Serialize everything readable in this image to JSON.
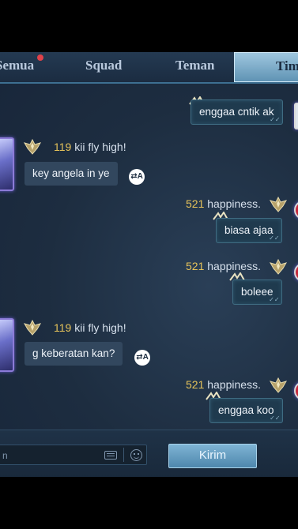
{
  "tabs": [
    {
      "label": "Semua",
      "has_dot": true
    },
    {
      "label": "Squad"
    },
    {
      "label": "Teman"
    },
    {
      "label": "Tim",
      "active": true
    }
  ],
  "messages": [
    {
      "side": "right",
      "text": "enggaa cntik ak"
    },
    {
      "side": "left",
      "level": "119",
      "name": "kii fly high!",
      "text": "key angela in ye",
      "translate": true
    },
    {
      "side": "right",
      "level": "521",
      "name": "happiness.",
      "text": "biasa ajaa"
    },
    {
      "side": "right",
      "level": "521",
      "name": "happiness.",
      "text": "boleee"
    },
    {
      "side": "left",
      "level": "119",
      "name": "kii fly high!",
      "text": "g keberatan kan?",
      "translate": true
    },
    {
      "side": "right",
      "level": "521",
      "name": "happiness.",
      "text": "enggaa koo"
    }
  ],
  "input": {
    "value": "",
    "placeholder": "n",
    "send_label": "Kirim"
  },
  "icons": {
    "keyboard": "keyboard-icon",
    "emoji": "emoji-icon",
    "translate": "translate-icon",
    "rank_badge": "rank-badge-icon"
  },
  "colors": {
    "level": "#e6c35a",
    "accent": "#5f93b4",
    "notification_dot": "#e0424a"
  }
}
